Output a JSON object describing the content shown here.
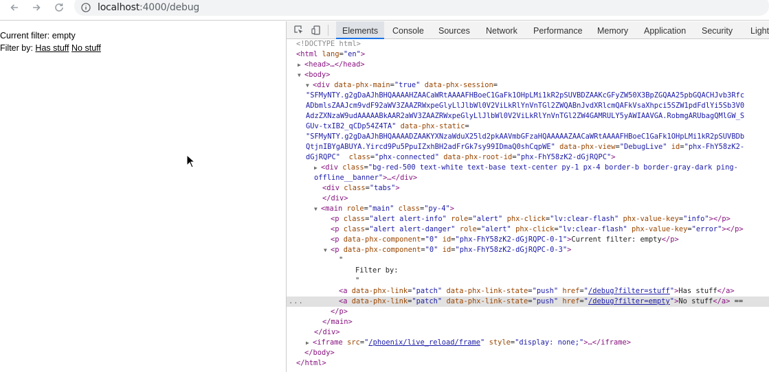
{
  "browser": {
    "url_host": "localhost",
    "url_path": ":4000/debug"
  },
  "page": {
    "current_filter_text": "Current filter: empty",
    "filter_by_label": "Filter by:",
    "link_has_stuff": "Has stuff",
    "link_no_stuff": "No stuff"
  },
  "devtools": {
    "tabs": [
      "Elements",
      "Console",
      "Sources",
      "Network",
      "Performance",
      "Memory",
      "Application",
      "Security",
      "Lighth"
    ],
    "active_tab": "Elements",
    "dom": {
      "doctype": "<!DOCTYPE html>",
      "html_open_tag": "<html",
      "html_lang_attr": "lang",
      "html_lang_val": "\"en\"",
      "gt": ">",
      "head_collapsed": "<head>…</head>",
      "body_open": "<body>",
      "div_open": "<div",
      "attr_phx_main": "data-phx-main",
      "val_true": "\"true\"",
      "attr_phx_session": "data-phx-session",
      "eq_quote": "=",
      "session_l1": "\"SFMyNTY.g2gDaAJhBHQAAAAHZAACaWRtAAAAFHBoeC1GaFk1OHpLMi1kR2pSUVBDZAAKcGFyZW50X3BpZGQAA25pbGQACHJvb3Rfc",
      "session_l2": "ADbmlsZAAJcm9vdF92aWV3ZAAZRWxpeGlyLlJlbWl0V2ViLkRlYnVnTGl2ZWQABnJvdXRlcmQAFkVsaXhpci5SZW1pdFdlYi5Sb3V0",
      "session_l3": "AdzZXNzaW9udAAAAABkAAR2aWV3ZAAZRWxpeGlyLlJlbWl0V2ViLkRlYnVnTGl2ZW4GAMRULY5yAWIAAVGA.RobmgARUbagQMlGW_S",
      "session_l4_val": "GUv-txIB2_qCDp54Z4TA\"",
      "attr_phx_static": "data-phx-static",
      "static_l1": "\"SFMyNTY.g2gDaAJhBHQAAAADZAAKYXNzaWduX25ld2pkAAVmbGFzaHQAAAAAZAACaWRtAAAAFHBoeC1GaFk1OHpLMi1kR2pSUVBDb",
      "static_l2_val": "QtjnIBYgABUYA.Yircd9Pu5PpuIZxhBH2adFrGk7sy99IDmaQ0shCqpWE\"",
      "attr_phx_view": "data-phx-view",
      "val_debuglive": "\"DebugLive\"",
      "attr_id": "id",
      "val_root_id_a": "\"phx-FhY58zK2-",
      "val_root_id_b": "dGjRQPC\"",
      "attr_class": "class",
      "val_phx_connected": "\"phx-connected\"",
      "attr_phx_root_id": "data-phx-root-id",
      "val_root_id_full": "\"phx-FhY58zK2-dGjRQPC\"",
      "banner_class_val": "\"bg-red-500 text-white text-base text-center py-1 px-4 border-b border-gray-dark ping-",
      "banner_class_end": "offline__banner\"",
      "collapsed_end_div": ">…</div>",
      "tabs_div": "<div",
      "val_tabs": "\"tabs\"",
      "div_close": "</div>",
      "main_open": "<main",
      "attr_role": "role",
      "val_main": "\"main\"",
      "val_py4": "\"py-4\"",
      "p_open": "<p",
      "val_alert_info": "\"alert alert-info\"",
      "val_alert_danger": "\"alert alert-danger\"",
      "val_alert": "\"alert\"",
      "attr_phx_click": "phx-click",
      "val_clear_flash": "\"lv:clear-flash\"",
      "attr_phx_value_key": "phx-value-key",
      "val_info": "\"info\"",
      "val_error": "\"error\"",
      "p_empty_close": "></p>",
      "attr_phx_component": "data-phx-component",
      "val_zero": "\"0\"",
      "val_comp_id_1": "\"phx-FhY58zK2-dGjRQPC-0-1\"",
      "val_comp_id_3": "\"phx-FhY58zK2-dGjRQPC-0-3\"",
      "current_filter_node": "Current filter: empty",
      "p_close": "</p>",
      "quote_char": "\"",
      "filter_by_node": "Filter by:",
      "a_open": "<a",
      "attr_phx_link": "data-phx-link",
      "val_patch": "\"patch\"",
      "attr_phx_link_state": "data-phx-link-state",
      "val_push": "\"push\"",
      "attr_href": "href",
      "href_stuff": "/debug?filter=stuff",
      "href_empty": "/debug?filter=empty",
      "a_close": "</a>",
      "has_stuff_node": "Has stuff",
      "no_stuff_node": "No stuff",
      "eq_marker": "==",
      "main_close": "</main>",
      "iframe_open": "<iframe",
      "attr_src": "src",
      "iframe_src": "/phoenix/live_reload/frame",
      "attr_style": "style",
      "val_display_none": "\"display: none;\"",
      "iframe_tail": ">…</iframe>",
      "body_close": "</body>",
      "html_close": "</html>",
      "ellipsis_marker": "..."
    }
  },
  "colors": {
    "tag": "#881280",
    "attr_name": "#994500",
    "attr_value": "#1a1aa6",
    "active_tab_underline": "#1a73e8",
    "selected_row": "#e1e1e1"
  }
}
